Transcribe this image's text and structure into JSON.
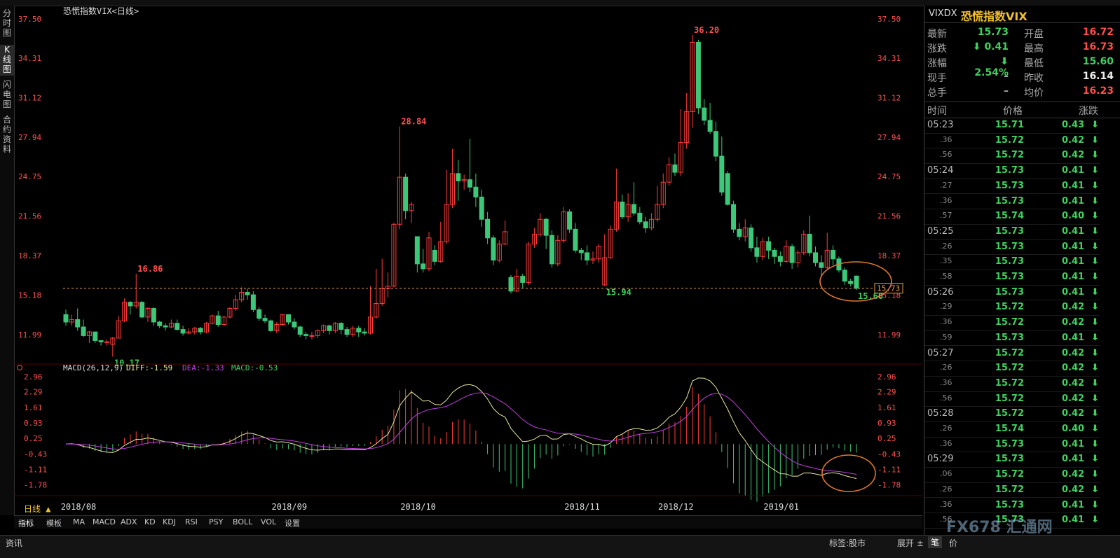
{
  "window": {
    "title": "恐慌指数VIX<日线>"
  },
  "left_tabs": [
    {
      "label": "分\n时\n图"
    },
    {
      "label": "K\n线\n图"
    },
    {
      "label": "闪\n电\n图"
    },
    {
      "label": "合\n约\n资\n料"
    }
  ],
  "chart_data": {
    "type": "candlestick",
    "title": "恐慌指数VIX<日线>",
    "dates": [
      "2018/08",
      "2018/09",
      "2018/10",
      "2018/11",
      "2018/12",
      "2019/01"
    ],
    "y_ticks": [
      "37.50",
      "34.31",
      "31.12",
      "27.94",
      "24.75",
      "21.56",
      "18.37",
      "15.18",
      "11.99"
    ],
    "ylim": [
      10.0,
      38.0
    ],
    "candles": [
      [
        13.6,
        13.0,
        14.0,
        12.7
      ],
      [
        13.0,
        13.2,
        13.6,
        12.7
      ],
      [
        13.2,
        12.6,
        14.1,
        12.3
      ],
      [
        12.6,
        11.9,
        13.2,
        11.8
      ],
      [
        11.9,
        12.2,
        12.3,
        11.3
      ],
      [
        12.2,
        11.5,
        12.2,
        11.3
      ],
      [
        11.5,
        11.4,
        11.5,
        11.1
      ],
      [
        11.4,
        11.4,
        11.6,
        11.1
      ],
      [
        11.2,
        11.7,
        11.8,
        10.2
      ],
      [
        11.7,
        13.1,
        13.5,
        11.7
      ],
      [
        13.1,
        14.6,
        14.9,
        13.0
      ],
      [
        14.6,
        14.3,
        14.7,
        13.6
      ],
      [
        14.3,
        14.6,
        16.9,
        14.1
      ],
      [
        14.6,
        13.4,
        14.7,
        13.3
      ],
      [
        13.4,
        14.1,
        14.2,
        13.0
      ],
      [
        14.1,
        13.0,
        14.2,
        12.7
      ],
      [
        13.0,
        12.7,
        13.1,
        12.5
      ],
      [
        12.7,
        12.6,
        12.9,
        12.3
      ],
      [
        12.6,
        12.9,
        13.2,
        12.5
      ],
      [
        12.9,
        12.4,
        13.2,
        12.3
      ],
      [
        12.4,
        12.1,
        12.7,
        11.9
      ],
      [
        12.1,
        12.2,
        12.5,
        12.0
      ],
      [
        12.2,
        12.5,
        12.6,
        12.0
      ],
      [
        12.5,
        12.2,
        12.6,
        12.0
      ],
      [
        12.2,
        12.9,
        13.0,
        12.1
      ],
      [
        12.9,
        13.5,
        13.6,
        12.8
      ],
      [
        13.5,
        12.8,
        13.9,
        12.6
      ],
      [
        12.8,
        13.4,
        13.5,
        12.7
      ],
      [
        13.4,
        14.1,
        14.2,
        13.3
      ],
      [
        14.1,
        14.8,
        15.2,
        13.9
      ],
      [
        14.8,
        15.4,
        15.8,
        14.6
      ],
      [
        15.4,
        15.2,
        15.7,
        14.8
      ],
      [
        15.2,
        14.0,
        15.5,
        13.8
      ],
      [
        14.0,
        13.3,
        14.2,
        13.1
      ],
      [
        13.3,
        13.1,
        13.6,
        12.9
      ],
      [
        13.1,
        12.3,
        13.2,
        12.2
      ],
      [
        12.3,
        12.8,
        13.0,
        12.1
      ],
      [
        12.8,
        13.6,
        13.6,
        12.7
      ],
      [
        13.6,
        13.0,
        13.6,
        12.8
      ],
      [
        13.0,
        12.6,
        13.3,
        12.4
      ],
      [
        12.6,
        12.0,
        12.7,
        11.8
      ],
      [
        12.0,
        11.9,
        12.2,
        11.6
      ],
      [
        11.9,
        11.9,
        12.2,
        11.6
      ],
      [
        11.9,
        12.3,
        12.4,
        11.7
      ],
      [
        12.3,
        12.7,
        12.8,
        12.1
      ],
      [
        12.7,
        12.3,
        12.8,
        12.0
      ],
      [
        12.3,
        12.9,
        13.0,
        12.1
      ],
      [
        12.9,
        12.4,
        13.0,
        12.0
      ],
      [
        12.4,
        12.0,
        12.6,
        11.8
      ],
      [
        12.0,
        12.5,
        12.7,
        11.8
      ],
      [
        12.5,
        12.2,
        12.7,
        11.8
      ],
      [
        12.2,
        12.1,
        12.5,
        11.9
      ],
      [
        12.1,
        13.4,
        15.9,
        12.0
      ],
      [
        13.4,
        14.5,
        17.3,
        13.3
      ],
      [
        14.5,
        15.7,
        18.1,
        14.3
      ],
      [
        15.7,
        15.9,
        17.0,
        15.0
      ],
      [
        15.9,
        20.9,
        21.0,
        15.8
      ],
      [
        20.9,
        24.7,
        28.8,
        20.5
      ],
      [
        24.7,
        22.0,
        25.0,
        21.3
      ],
      [
        22.0,
        22.5,
        22.7,
        21.0
      ],
      [
        19.9,
        17.7,
        19.9,
        17.0
      ],
      [
        17.7,
        17.3,
        18.9,
        17.0
      ],
      [
        17.3,
        19.8,
        20.3,
        17.1
      ],
      [
        18.8,
        17.9,
        19.2,
        17.6
      ],
      [
        17.9,
        19.5,
        21.1,
        17.8
      ],
      [
        19.5,
        22.5,
        25.3,
        19.3
      ],
      [
        22.5,
        25.0,
        27.0,
        22.2
      ],
      [
        25.0,
        24.4,
        26.1,
        22.8
      ],
      [
        24.4,
        24.5,
        24.9,
        23.7
      ],
      [
        24.5,
        23.9,
        27.8,
        23.5
      ],
      [
        23.9,
        23.1,
        25.0,
        22.3
      ],
      [
        23.1,
        21.3,
        23.7,
        20.7
      ],
      [
        21.3,
        19.8,
        21.9,
        19.3
      ],
      [
        19.8,
        18.0,
        20.0,
        17.6
      ],
      [
        18.0,
        19.3,
        19.6,
        17.8
      ],
      [
        19.3,
        20.3,
        21.2,
        19.2
      ],
      [
        16.6,
        15.5,
        16.8,
        15.3
      ],
      [
        15.5,
        16.7,
        17.3,
        15.4
      ],
      [
        16.7,
        16.2,
        16.9,
        15.7
      ],
      [
        16.2,
        19.3,
        19.5,
        16.0
      ],
      [
        19.3,
        20.1,
        20.6,
        19.0
      ],
      [
        20.1,
        21.3,
        21.8,
        19.9
      ],
      [
        21.3,
        20.0,
        21.4,
        18.9
      ],
      [
        20.0,
        17.7,
        20.4,
        17.4
      ],
      [
        17.7,
        19.6,
        20.0,
        17.5
      ],
      [
        19.6,
        21.9,
        22.3,
        19.4
      ],
      [
        21.9,
        20.5,
        22.1,
        20.2
      ],
      [
        20.5,
        18.8,
        21.0,
        18.6
      ],
      [
        18.8,
        18.6,
        19.0,
        18.0
      ],
      [
        18.6,
        18.0,
        19.2,
        17.6
      ],
      [
        18.0,
        18.1,
        18.7,
        17.7
      ],
      [
        18.1,
        19.1,
        19.3,
        17.8
      ],
      [
        16.0,
        18.2,
        20.1,
        15.9
      ],
      [
        18.2,
        20.5,
        20.8,
        18.1
      ],
      [
        20.5,
        22.7,
        25.4,
        20.3
      ],
      [
        22.7,
        21.5,
        23.3,
        21.3
      ],
      [
        21.5,
        22.5,
        23.4,
        21.1
      ],
      [
        22.5,
        21.8,
        24.3,
        21.6
      ],
      [
        21.8,
        21.1,
        22.3,
        20.9
      ],
      [
        21.1,
        20.6,
        21.5,
        20.2
      ],
      [
        20.6,
        21.3,
        21.8,
        20.4
      ],
      [
        21.3,
        22.5,
        24.0,
        21.1
      ],
      [
        22.5,
        24.3,
        25.0,
        22.2
      ],
      [
        24.3,
        25.7,
        26.3,
        24.0
      ],
      [
        25.7,
        25.1,
        26.6,
        24.8
      ],
      [
        25.1,
        27.5,
        30.2,
        24.8
      ],
      [
        27.5,
        30.0,
        31.5,
        27.0
      ],
      [
        30.0,
        35.6,
        36.2,
        28.7
      ],
      [
        35.6,
        30.3,
        35.8,
        29.8
      ],
      [
        30.3,
        29.3,
        31.0,
        28.9
      ],
      [
        29.3,
        28.4,
        30.7,
        28.2
      ],
      [
        28.4,
        26.4,
        29.2,
        26.0
      ],
      [
        26.4,
        23.5,
        28.0,
        23.2
      ],
      [
        25.0,
        22.5,
        25.2,
        22.4
      ],
      [
        22.5,
        20.5,
        22.8,
        20.2
      ],
      [
        20.5,
        19.9,
        21.0,
        19.6
      ],
      [
        19.9,
        20.6,
        21.3,
        19.5
      ],
      [
        20.6,
        19.0,
        20.9,
        18.7
      ],
      [
        19.0,
        18.3,
        19.9,
        17.8
      ],
      [
        18.3,
        19.5,
        19.8,
        18.0
      ],
      [
        19.5,
        18.8,
        19.9,
        18.1
      ],
      [
        18.8,
        18.3,
        19.0,
        17.7
      ],
      [
        18.3,
        17.9,
        18.7,
        17.5
      ],
      [
        17.9,
        19.1,
        19.6,
        17.8
      ],
      [
        19.1,
        17.8,
        19.3,
        17.3
      ],
      [
        17.8,
        18.6,
        18.8,
        17.4
      ],
      [
        18.6,
        20.1,
        20.4,
        18.4
      ],
      [
        20.1,
        18.6,
        21.6,
        18.3
      ],
      [
        18.6,
        17.8,
        19.1,
        17.5
      ],
      [
        17.8,
        17.4,
        18.4,
        16.6
      ],
      [
        17.4,
        18.8,
        20.2,
        17.2
      ],
      [
        18.8,
        18.1,
        19.2,
        17.6
      ],
      [
        18.1,
        17.2,
        18.3,
        17.0
      ],
      [
        17.2,
        16.3,
        17.4,
        16.0
      ],
      [
        16.3,
        16.1,
        16.5,
        15.9
      ],
      [
        16.72,
        15.73,
        16.73,
        15.6
      ]
    ],
    "high_mark": {
      "label": "36.20"
    },
    "low_mark": {
      "label": "10.17"
    },
    "peak_labels": [
      "16.86",
      "28.84",
      "15.94",
      "15.60"
    ],
    "last_price_tag": "15.73",
    "macd": {
      "header": "MACD(26,12,9)",
      "diff_label": "DIFF:-1.59",
      "dea_label": "DEA:-1.33",
      "macd_label": "MACD:-0.53",
      "y_ticks": [
        "2.96",
        "2.29",
        "1.61",
        "0.93",
        "0.25",
        "-0.43",
        "-1.11",
        "-1.78"
      ],
      "ylim": [
        -2.2,
        3.2
      ]
    }
  },
  "indicator_tabs": {
    "left_label": "日线 ▲",
    "tab1": "指标",
    "tab2": "模板",
    "items": [
      "MA",
      "MACD",
      "ADX",
      "KD",
      "KDJ",
      "RSI",
      "PSY",
      "BOLL",
      "VOL",
      "设置"
    ]
  },
  "quote": {
    "code": "VIXDX",
    "name": "恐慌指数VIX",
    "rows": [
      {
        "l1": "最新",
        "v1": "15.73",
        "c1": "grn",
        "l2": "开盘",
        "v2": "16.72",
        "c2": "red"
      },
      {
        "l1": "涨跌",
        "v1": "⬇ 0.41",
        "c1": "grn",
        "l2": "最高",
        "v2": "16.73",
        "c2": "red"
      },
      {
        "l1": "涨幅",
        "v1": "⬇ 2.54%",
        "c1": "grn",
        "l2": "最低",
        "v2": "15.60",
        "c2": "grn"
      },
      {
        "l1": "现手",
        "v1": "–",
        "c1": "lbl",
        "l2": "昨收",
        "v2": "16.14",
        "c2": "white"
      },
      {
        "l1": "总手",
        "v1": "–",
        "c1": "lbl",
        "l2": "均价",
        "v2": "16.23",
        "c2": "red"
      }
    ],
    "tick_header": {
      "time": "时间",
      "price": "价格",
      "change": "涨跌"
    },
    "ticks": [
      {
        "time": "05:23",
        "sub": false,
        "price": "15.71",
        "change": "0.43"
      },
      {
        "time": ".36",
        "sub": true,
        "price": "15.72",
        "change": "0.42"
      },
      {
        "time": ".56",
        "sub": true,
        "price": "15.72",
        "change": "0.42"
      },
      {
        "time": "05:24",
        "sub": false,
        "price": "15.73",
        "change": "0.41"
      },
      {
        "time": ".27",
        "sub": true,
        "price": "15.73",
        "change": "0.41"
      },
      {
        "time": ".36",
        "sub": true,
        "price": "15.73",
        "change": "0.41"
      },
      {
        "time": ".57",
        "sub": true,
        "price": "15.74",
        "change": "0.40"
      },
      {
        "time": "05:25",
        "sub": false,
        "price": "15.73",
        "change": "0.41"
      },
      {
        "time": ".26",
        "sub": true,
        "price": "15.73",
        "change": "0.41"
      },
      {
        "time": ".35",
        "sub": true,
        "price": "15.73",
        "change": "0.41"
      },
      {
        "time": ".58",
        "sub": true,
        "price": "15.73",
        "change": "0.41"
      },
      {
        "time": "05:26",
        "sub": false,
        "price": "15.73",
        "change": "0.41"
      },
      {
        "time": ".29",
        "sub": true,
        "price": "15.72",
        "change": "0.42"
      },
      {
        "time": ".36",
        "sub": true,
        "price": "15.72",
        "change": "0.42"
      },
      {
        "time": ".59",
        "sub": true,
        "price": "15.73",
        "change": "0.41"
      },
      {
        "time": "05:27",
        "sub": false,
        "price": "15.72",
        "change": "0.42"
      },
      {
        "time": ".26",
        "sub": true,
        "price": "15.72",
        "change": "0.42"
      },
      {
        "time": ".36",
        "sub": true,
        "price": "15.72",
        "change": "0.42"
      },
      {
        "time": ".56",
        "sub": true,
        "price": "15.72",
        "change": "0.42"
      },
      {
        "time": "05:28",
        "sub": false,
        "price": "15.72",
        "change": "0.42"
      },
      {
        "time": ".26",
        "sub": true,
        "price": "15.74",
        "change": "0.40"
      },
      {
        "time": ".36",
        "sub": true,
        "price": "15.73",
        "change": "0.41"
      },
      {
        "time": "05:29",
        "sub": false,
        "price": "15.73",
        "change": "0.41"
      },
      {
        "time": ".06",
        "sub": true,
        "price": "15.72",
        "change": "0.42"
      },
      {
        "time": ".26",
        "sub": true,
        "price": "15.72",
        "change": "0.42"
      },
      {
        "time": ".36",
        "sub": true,
        "price": "15.73",
        "change": "0.41"
      },
      {
        "time": ".56",
        "sub": true,
        "price": "15.73",
        "change": "0.41"
      }
    ]
  },
  "status": {
    "left": "资讯",
    "tag": "标签:股市",
    "expand": "展开 ±",
    "bi": "笔",
    "jia": "价"
  },
  "watermark": "FX678 汇通网",
  "colors": {
    "up": "#ff3c3c",
    "down": "#3cc878",
    "diff": "#e8e8a0",
    "dea": "#c040e0",
    "bg": "#000000",
    "grid": "#2a0000"
  }
}
